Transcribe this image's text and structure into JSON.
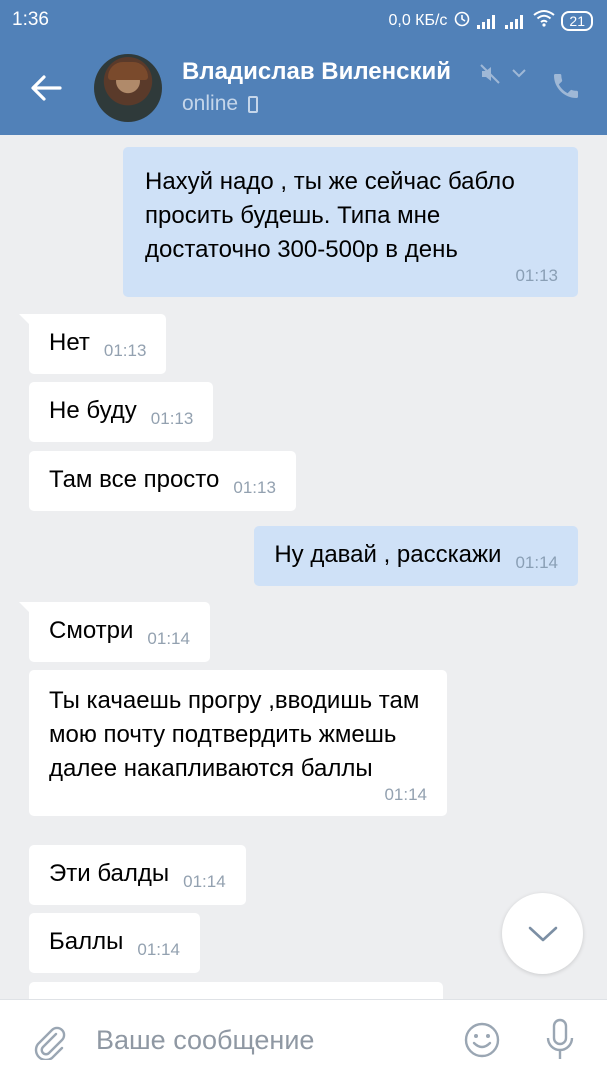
{
  "status": {
    "time": "1:36",
    "network_speed": "0,0 КБ/с",
    "battery": "21"
  },
  "header": {
    "contact_name": "Владислав Виленский",
    "contact_status": "online"
  },
  "messages": [
    {
      "dir": "out",
      "text": "Нахуй надо , ты же сейчас бабло просить будешь. Типа мне достаточно 300-500р в день",
      "time": "01:13"
    },
    {
      "dir": "in",
      "text": "Нет",
      "time": "01:13"
    },
    {
      "dir": "in",
      "text": "Не буду",
      "time": "01:13"
    },
    {
      "dir": "in",
      "text": "Там все просто",
      "time": "01:13"
    },
    {
      "dir": "out",
      "text": "Ну давай , расскажи",
      "time": "01:14"
    },
    {
      "dir": "in",
      "text": "Смотри",
      "time": "01:14"
    },
    {
      "dir": "in",
      "text": "Ты качаешь прогру ,вводишь там мою почту подтвердить жмешь далее накапливаются баллы",
      "time": "01:14"
    },
    {
      "dir": "in",
      "text": "Эти балды",
      "time": "01:14"
    },
    {
      "dir": "in",
      "text": "Баллы",
      "time": "01:14"
    }
  ],
  "composer": {
    "placeholder": "Ваше сообщение"
  },
  "colors": {
    "header": "#5181b8",
    "outgoing_bubble": "#cfe1f7",
    "incoming_bubble": "#ffffff",
    "background": "#edeef0"
  }
}
